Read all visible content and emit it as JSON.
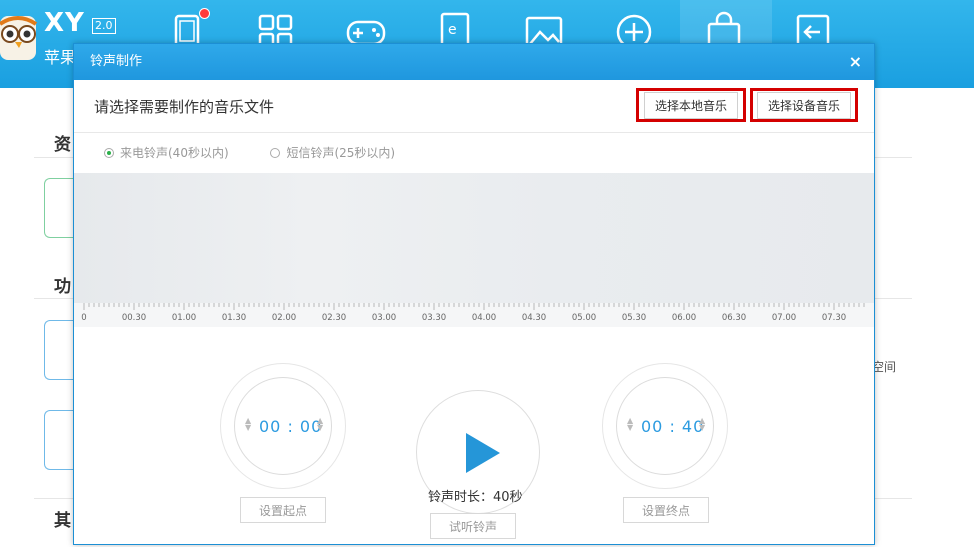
{
  "app": {
    "brand": "XY",
    "version": "2.0",
    "subtitle": "苹果"
  },
  "nav": {
    "icons": [
      "tablet-icon",
      "apps-grid-icon",
      "gamepad-icon",
      "ebook-icon",
      "image-icon",
      "add-circle-icon",
      "shopping-bag-icon",
      "exit-icon"
    ]
  },
  "background": {
    "section_1": "资",
    "section_2": "功",
    "section_3": "其",
    "right_text": "空间"
  },
  "dialog": {
    "title": "铃声制作",
    "close": "×",
    "prompt": "请选择需要制作的音乐文件",
    "btn_local": "选择本地音乐",
    "btn_device": "选择设备音乐",
    "radio_call": "来电铃声(40秒以内)",
    "radio_sms": "短信铃声(25秒以内)",
    "timeline_ticks": [
      "0",
      "00.30",
      "01.00",
      "01.30",
      "02.00",
      "02.30",
      "03.00",
      "03.30",
      "04.00",
      "04.30",
      "05.00",
      "05.30",
      "06.00",
      "06.30",
      "07.00",
      "07.30"
    ],
    "start_time": "00 : 00",
    "end_time": "00 : 40",
    "duration": "铃声时长：40秒",
    "btn_set_start": "设置起点",
    "btn_set_end": "设置终点",
    "btn_preview": "试听铃声"
  },
  "colors": {
    "header_blue": "#1f9fe0",
    "accent_blue": "#2596d8",
    "highlight_red": "#d40000",
    "radio_green": "#2bb04a"
  }
}
